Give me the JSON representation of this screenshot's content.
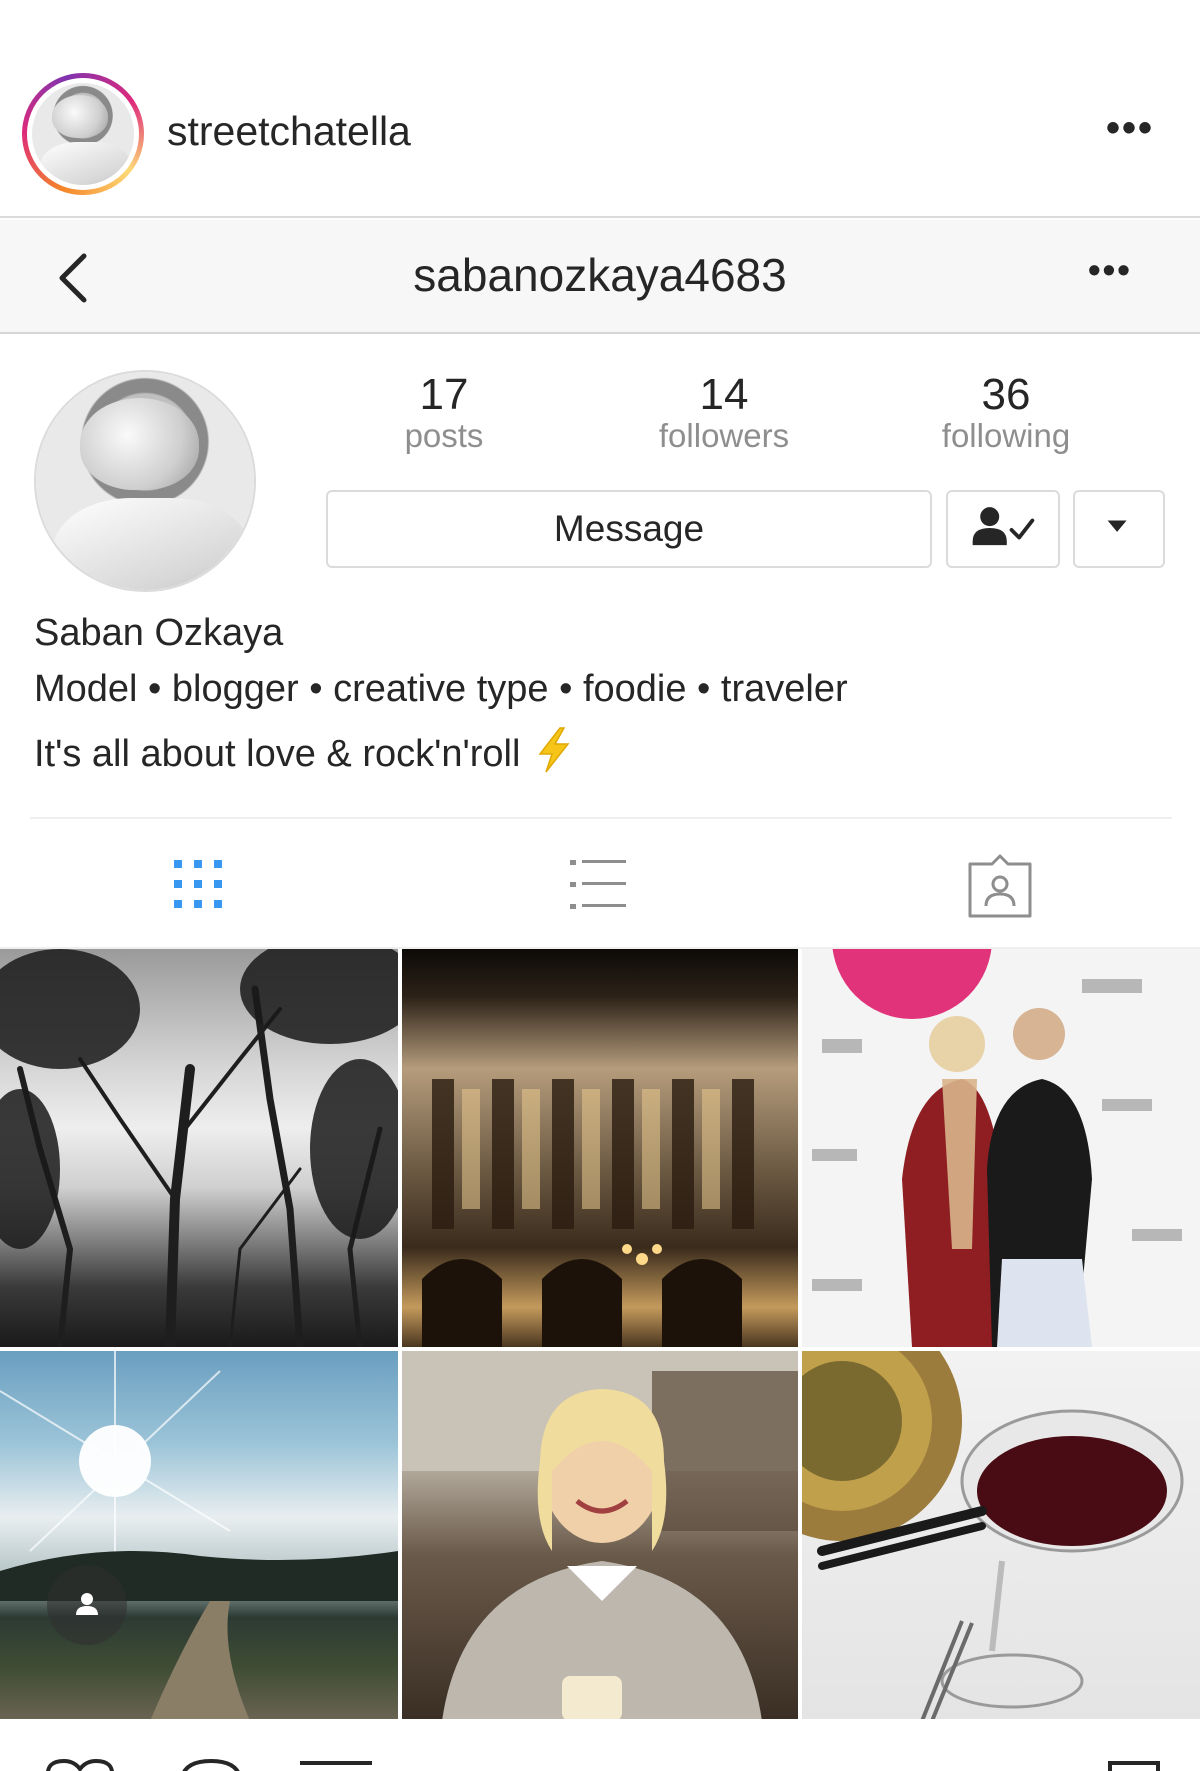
{
  "post_header": {
    "username": "streetchatella",
    "more_icon": "more-horizontal-icon"
  },
  "nav": {
    "back_icon": "chevron-left-icon",
    "title": "sabanozkaya4683",
    "more_icon": "more-horizontal-icon"
  },
  "profile": {
    "stats": [
      {
        "value": "17",
        "label": "posts"
      },
      {
        "value": "14",
        "label": "followers"
      },
      {
        "value": "36",
        "label": "following"
      }
    ],
    "message_label": "Message",
    "following_icon": "person-check-icon",
    "dropdown_icon": "caret-down-icon",
    "name": "Saban Ozkaya",
    "bio_line_1": "Model • blogger • creative type • foodie • traveler",
    "bio_line_2": "It's all about love & rock'n'roll",
    "bio_emoji_icon": "lightning-bolt-icon"
  },
  "tabs": [
    {
      "icon": "grid-view-icon",
      "active": true
    },
    {
      "icon": "list-view-icon",
      "active": false
    },
    {
      "icon": "tagged-photos-icon",
      "active": false
    }
  ],
  "grid": {
    "photos": [
      {
        "subject": "bare trees from below, black and white"
      },
      {
        "subject": "ornate opera house facade at night"
      },
      {
        "subject": "two women at a press wall event"
      },
      {
        "subject": "sunlit sky over misty field with dirt path"
      },
      {
        "subject": "smiling blonde woman at a restaurant table"
      },
      {
        "subject": "red wine glasses and patterned plate"
      }
    ],
    "tagged_badge_icon": "person-tag-icon"
  },
  "colors": {
    "text": "#262626",
    "secondary_text": "#8e8e8e",
    "active_tab": "#3897f0",
    "border": "#dbdbdb",
    "nav_bg": "#f7f7f7",
    "bolt": "#f5c518"
  }
}
